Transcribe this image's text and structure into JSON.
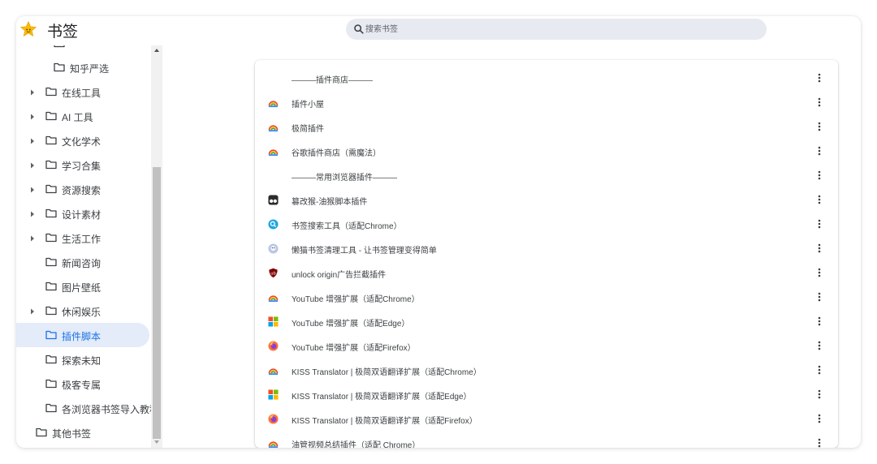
{
  "app": {
    "title": "书签"
  },
  "search": {
    "placeholder": "搜索书签"
  },
  "sidebar": {
    "items": [
      {
        "label": "知乎严选",
        "icon": "folder-icon",
        "expandable": false,
        "selected": false
      },
      {
        "label": "在线工具",
        "icon": "folder-icon",
        "expandable": true,
        "selected": false
      },
      {
        "label": "AI 工具",
        "icon": "folder-icon",
        "expandable": true,
        "selected": false
      },
      {
        "label": "文化学术",
        "icon": "folder-icon",
        "expandable": true,
        "selected": false
      },
      {
        "label": "学习合集",
        "icon": "folder-icon",
        "expandable": true,
        "selected": false
      },
      {
        "label": "资源搜索",
        "icon": "folder-icon",
        "expandable": true,
        "selected": false
      },
      {
        "label": "设计素材",
        "icon": "folder-icon",
        "expandable": true,
        "selected": false
      },
      {
        "label": "生活工作",
        "icon": "folder-icon",
        "expandable": true,
        "selected": false
      },
      {
        "label": "新闻咨询",
        "icon": "folder-icon",
        "expandable": false,
        "selected": false
      },
      {
        "label": "图片壁纸",
        "icon": "folder-icon",
        "expandable": false,
        "selected": false
      },
      {
        "label": "休闲娱乐",
        "icon": "folder-icon",
        "expandable": true,
        "selected": false
      },
      {
        "label": "插件脚本",
        "icon": "folder-icon",
        "expandable": false,
        "selected": true
      },
      {
        "label": "探索未知",
        "icon": "folder-icon",
        "expandable": false,
        "selected": false
      },
      {
        "label": "极客专属",
        "icon": "folder-icon",
        "expandable": false,
        "selected": false
      },
      {
        "label": "各浏览器书签导入教程",
        "icon": "folder-icon",
        "expandable": false,
        "selected": false
      },
      {
        "label": "其他书签",
        "icon": "folder-icon",
        "expandable": false,
        "selected": false
      }
    ]
  },
  "bookmarks": [
    {
      "title": "———插件商店———",
      "icon": "none"
    },
    {
      "title": "插件小屋",
      "icon": "rainbow-favicon-icon"
    },
    {
      "title": "极简插件",
      "icon": "rainbow-favicon-icon"
    },
    {
      "title": "谷歌插件商店（需魔法）",
      "icon": "rainbow-favicon-icon"
    },
    {
      "title": "———常用浏览器插件———",
      "icon": "none"
    },
    {
      "title": "篡改猴-油猴脚本插件",
      "icon": "tampermonkey-icon"
    },
    {
      "title": "书签搜索工具（适配Chrome）",
      "icon": "bookmark-search-icon"
    },
    {
      "title": "懒猫书签清理工具 - 让书签管理变得简单",
      "icon": "lazycat-icon"
    },
    {
      "title": "unlock origin广告拦截插件",
      "icon": "ublock-shield-icon"
    },
    {
      "title": "YouTube 增强扩展（适配Chrome）",
      "icon": "rainbow-favicon-icon"
    },
    {
      "title": "YouTube 增强扩展（适配Edge）",
      "icon": "microsoft-store-icon"
    },
    {
      "title": "YouTube 增强扩展（适配Firefox）",
      "icon": "firefox-icon"
    },
    {
      "title": "KISS Translator | 极简双语翻译扩展（适配Chrome）",
      "icon": "rainbow-favicon-icon"
    },
    {
      "title": "KISS Translator | 极简双语翻译扩展（适配Edge）",
      "icon": "microsoft-store-icon"
    },
    {
      "title": "KISS Translator | 极简双语翻译扩展（适配Firefox）",
      "icon": "firefox-icon"
    },
    {
      "title": "油管视频总结插件（适配 Chrome）",
      "icon": "rainbow-favicon-icon"
    }
  ],
  "colors": {
    "accent": "#1a73e8",
    "selected_bg": "#e4ebf9",
    "search_bg": "#e8eaf2",
    "text": "#3c4043"
  }
}
